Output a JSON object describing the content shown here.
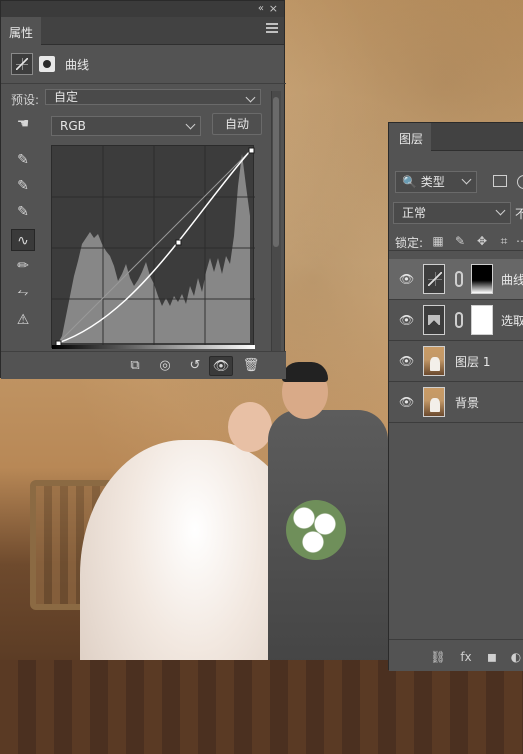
{
  "props_panel": {
    "tab_label": "属性",
    "adjustment_title": "曲线",
    "preset_label": "预设:",
    "preset_value": "自定",
    "channel_value": "RGB",
    "auto_label": "自动"
  },
  "layers_panel": {
    "tab_label": "图层",
    "filter_label": "类型",
    "blend_mode": "正常",
    "opacity_partial": "不",
    "lock_label": "锁定:",
    "layers": [
      {
        "name": "曲线",
        "type": "curves-adjustment",
        "selected": true,
        "mask": "gradient"
      },
      {
        "name": "选取",
        "type": "selective-color-adjustment",
        "selected": false,
        "mask": "white"
      },
      {
        "name": "图层 1",
        "type": "pixel",
        "selected": false
      },
      {
        "name": "背景",
        "type": "background",
        "selected": false
      }
    ]
  },
  "theme": {
    "panel_bg": "#535353",
    "panel_dark": "#3b3b3b",
    "text": "#d8d8d8"
  }
}
